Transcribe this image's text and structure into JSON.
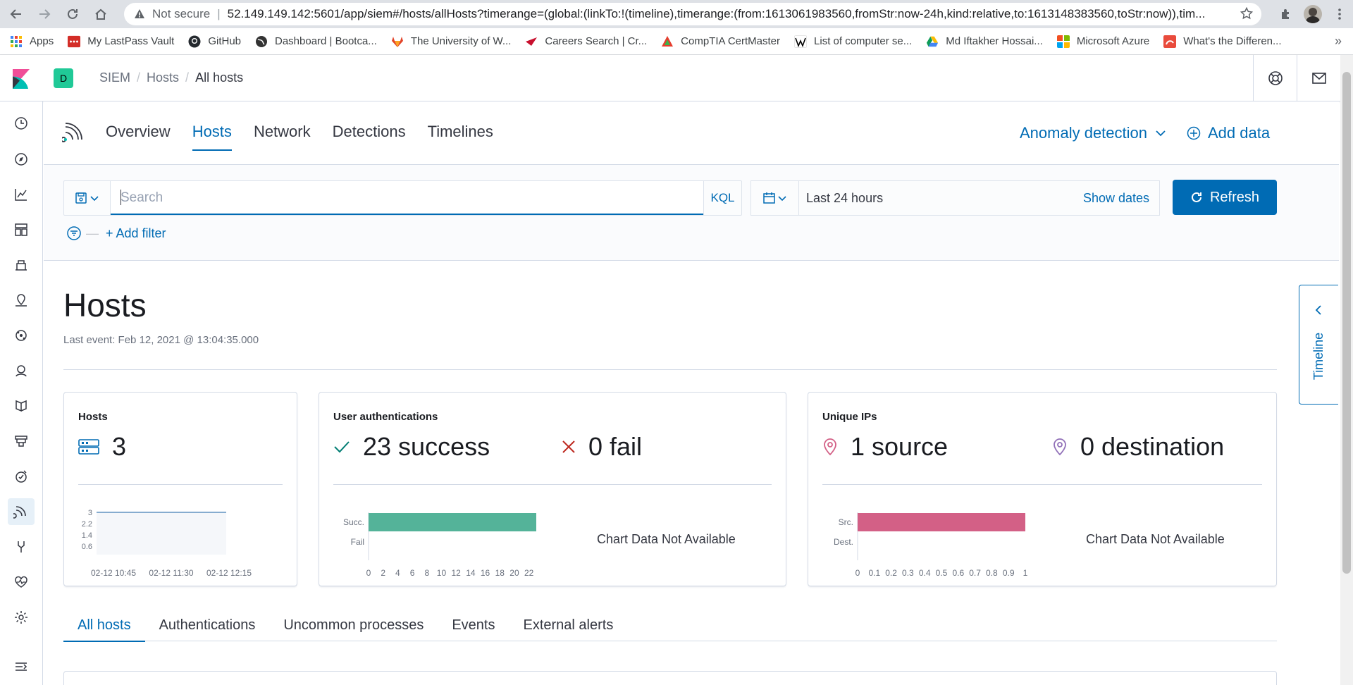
{
  "browser": {
    "security_label": "Not secure",
    "url": "52.149.149.142:5601/app/siem#/hosts/allHosts?timerange=(global:(linkTo:!(timeline),timerange:(from:1613061983560,fromStr:now-24h,kind:relative,to:1613148383560,toStr:now)),tim..."
  },
  "bookmarks": [
    {
      "label": "Apps",
      "color": "#4285f4"
    },
    {
      "label": "My LastPass Vault",
      "color": "#d32d27"
    },
    {
      "label": "GitHub",
      "color": "#24292e"
    },
    {
      "label": "Dashboard | Bootca...",
      "color": "#333333"
    },
    {
      "label": "The University of W...",
      "color": "#e24329"
    },
    {
      "label": "Careers Search | Cr...",
      "color": "#c8102e"
    },
    {
      "label": "CompTIA CertMaster",
      "color": "#e63d2d"
    },
    {
      "label": "List of computer se...",
      "color": "#000000"
    },
    {
      "label": "Md Iftakher Hossai...",
      "color": "#0f9d58"
    },
    {
      "label": "Microsoft Azure",
      "color": "#f25022"
    },
    {
      "label": "What's the Differen...",
      "color": "#e94b3c"
    }
  ],
  "kibana": {
    "space": "D",
    "breadcrumbs": [
      "SIEM",
      "Hosts",
      "All hosts"
    ]
  },
  "subnav": {
    "tabs": [
      "Overview",
      "Hosts",
      "Network",
      "Detections",
      "Timelines"
    ],
    "active_tab": "Hosts",
    "anomaly": "Anomaly detection",
    "add_data": "Add data"
  },
  "querybar": {
    "search_placeholder": "Search",
    "kql": "KQL",
    "date_range": "Last 24 hours",
    "show_dates": "Show dates",
    "refresh": "Refresh",
    "add_filter": "+ Add filter"
  },
  "page": {
    "title": "Hosts",
    "last_event": "Last event: Feb 12, 2021 @ 13:04:35.000"
  },
  "panels": {
    "hosts": {
      "title": "Hosts",
      "value": "3",
      "y_ticks": [
        "3",
        "2.2",
        "1.4",
        "0.6"
      ],
      "x_ticks": [
        "02-12 10:45",
        "02-12 11:30",
        "02-12 12:15"
      ]
    },
    "auth": {
      "title": "User authentications",
      "success": "23 success",
      "fail": "0 fail",
      "categories": [
        "Succ.",
        "Fail"
      ],
      "x_ticks": [
        "0",
        "2",
        "4",
        "6",
        "8",
        "10",
        "12",
        "14",
        "16",
        "18",
        "20",
        "22"
      ],
      "na": "Chart Data Not Available",
      "bar_color": "#54b399"
    },
    "ips": {
      "title": "Unique IPs",
      "source": "1 source",
      "destination": "0 destination",
      "categories": [
        "Src.",
        "Dest."
      ],
      "x_ticks": [
        "0",
        "0.1",
        "0.2",
        "0.3",
        "0.4",
        "0.5",
        "0.6",
        "0.7",
        "0.8",
        "0.9",
        "1"
      ],
      "na": "Chart Data Not Available",
      "bar_color": "#d36086"
    }
  },
  "chart_data": [
    {
      "type": "line",
      "x": [
        "02-12 10:45",
        "02-12 11:30",
        "02-12 12:15"
      ],
      "series": [
        {
          "values": [
            3,
            3,
            3
          ]
        }
      ],
      "ylim": [
        0,
        3
      ]
    },
    {
      "type": "bar",
      "orientation": "horizontal",
      "categories": [
        "Succ.",
        "Fail"
      ],
      "values": [
        23,
        0
      ],
      "xlim": [
        0,
        23
      ]
    },
    {
      "type": "bar",
      "orientation": "horizontal",
      "categories": [
        "Src.",
        "Dest."
      ],
      "values": [
        1,
        0
      ],
      "xlim": [
        0,
        1
      ]
    }
  ],
  "bottom_tabs": [
    "All hosts",
    "Authentications",
    "Uncommon processes",
    "Events",
    "External alerts"
  ],
  "active_bottom_tab": "All hosts",
  "timeline_flyout": "Timeline",
  "colors": {
    "accent": "#006bb4",
    "success": "#54b399",
    "danger": "#bd271e",
    "ip_source": "#d36086",
    "ip_dest": "#9170b8"
  }
}
